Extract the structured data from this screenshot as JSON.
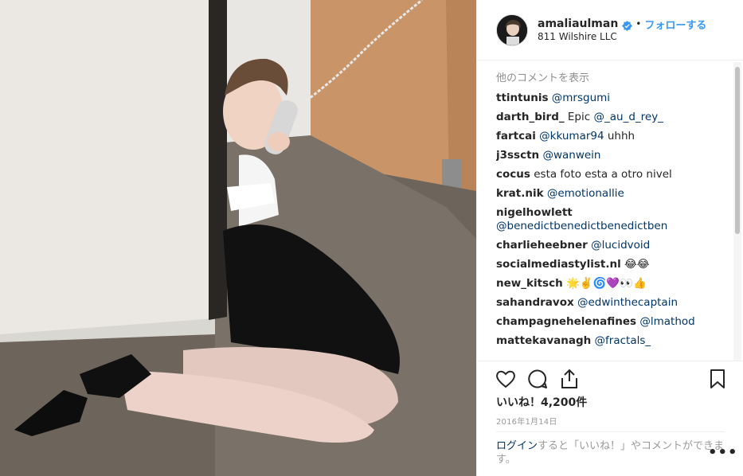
{
  "post": {
    "username": "amaliaulman",
    "verified_icon": "verified-badge-icon",
    "separator": "•",
    "follow_label": "フォローする",
    "location": "811 Wilshire LLC"
  },
  "comments_section": {
    "load_more": "他のコメントを表示",
    "items": [
      {
        "user": "ttintunis",
        "text": "",
        "mention": "@mrsgumi"
      },
      {
        "user": "darth_bird_",
        "text": "Epic",
        "mention": "@_au_d_rey_"
      },
      {
        "user": "fartcai",
        "text": "",
        "mention": "@kkumar94",
        "after": "uhhh"
      },
      {
        "user": "j3ssctn",
        "text": "",
        "mention": "@wanwein"
      },
      {
        "user": "cocus",
        "text": "esta foto esta a otro nivel",
        "mention": ""
      },
      {
        "user": "krat.nik",
        "text": "",
        "mention": "@emotionallie"
      },
      {
        "user": "nigelhowlett",
        "text": "",
        "mention": "@benedictbenedictbenedictben"
      },
      {
        "user": "charlieheebner",
        "text": "",
        "mention": "@lucidvoid"
      },
      {
        "user": "socialmediastylist.nl",
        "text": "😂😂",
        "mention": ""
      },
      {
        "user": "new_kitsch",
        "text": "🌟✌️🌀💜👀👍",
        "mention": ""
      },
      {
        "user": "sahandravox",
        "text": "",
        "mention": "@edwinthecaptain"
      },
      {
        "user": "champagnehelenafines",
        "text": "",
        "mention": "@lmathod"
      },
      {
        "user": "mattekavanagh",
        "text": "",
        "mention": "@fractals_"
      }
    ]
  },
  "actions": {
    "icons": [
      "heart-icon",
      "comment-icon",
      "share-icon",
      "bookmark-icon"
    ]
  },
  "likes": "いいね！4,200件",
  "date": "2016年1月14日",
  "login_prompt": {
    "link": "ログイン",
    "rest": "すると「いいね！」やコメントができます。"
  },
  "more_options": "•••",
  "colors": {
    "accent_blue": "#3897f0",
    "mention_blue": "#003569",
    "muted_gray": "#8e8e8e",
    "border": "#efefef"
  }
}
